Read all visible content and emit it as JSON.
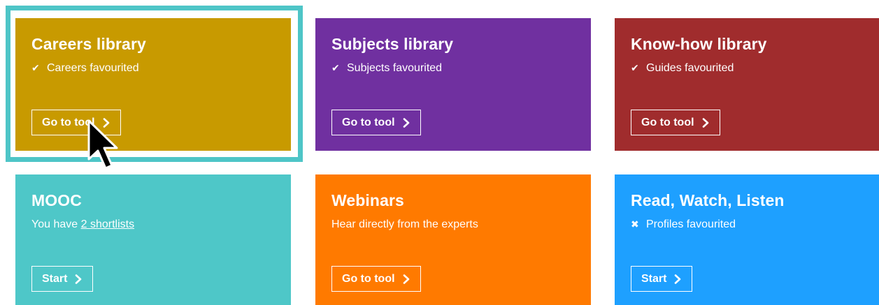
{
  "tiles": [
    {
      "id": "careers",
      "title": "Careers library",
      "sub_mark": "✔",
      "sub_text": "Careers favourited",
      "button": "Go to tool",
      "color": "#c89a00"
    },
    {
      "id": "subjects",
      "title": "Subjects library",
      "sub_mark": "✔",
      "sub_text": "Subjects favourited",
      "button": "Go to tool",
      "color": "#7030a0"
    },
    {
      "id": "knowhow",
      "title": "Know-how library",
      "sub_mark": "✔",
      "sub_text": "Guides favourited",
      "button": "Go to tool",
      "color": "#a02c2d"
    },
    {
      "id": "mooc",
      "title": "MOOC",
      "sub_prefix": "You have ",
      "sub_link": "2 shortlists",
      "button": "Start",
      "color": "#4ec7c8"
    },
    {
      "id": "webinars",
      "title": "Webinars",
      "sub_text": "Hear directly from the experts",
      "button": "Go to tool",
      "color": "#ff7a00"
    },
    {
      "id": "rwl",
      "title": "Read, Watch, Listen",
      "sub_mark": "✖",
      "sub_text": "Profiles favourited",
      "button": "Start",
      "color": "#1ea0ff"
    }
  ],
  "highlight_color": "#4ec5c7",
  "cursor_icon": "mouse-pointer-icon"
}
